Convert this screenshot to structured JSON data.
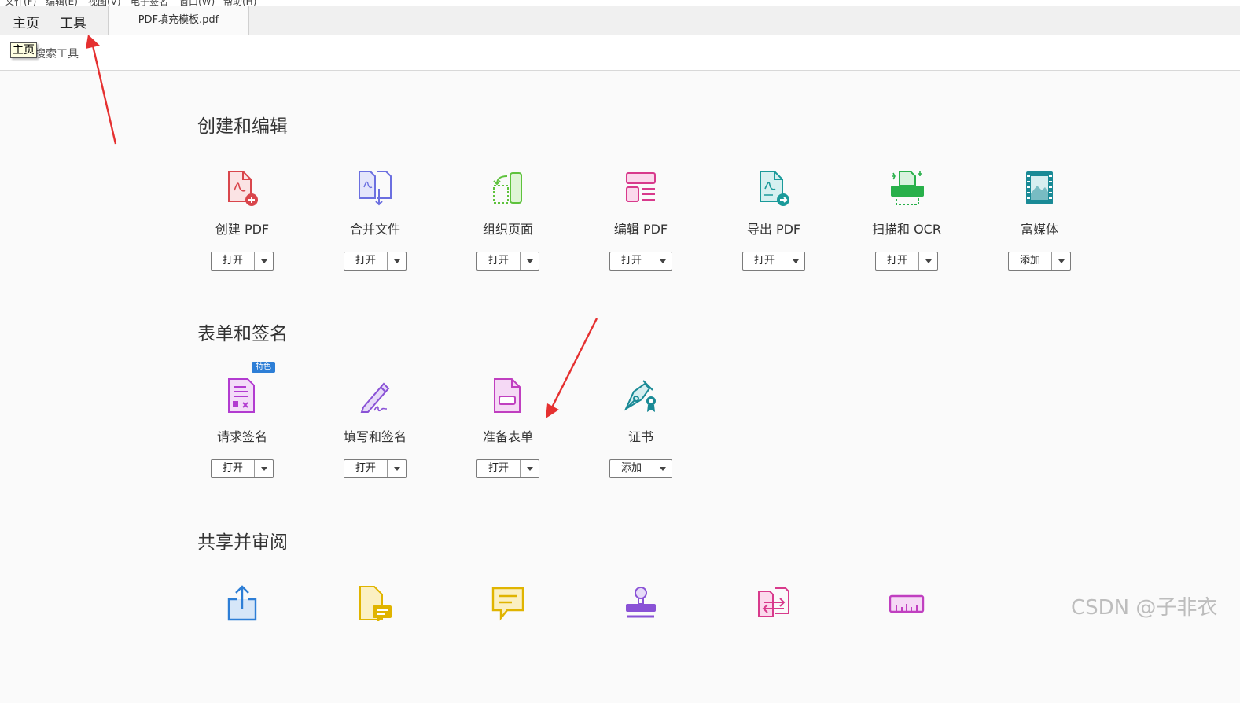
{
  "menubar": {
    "items": [
      "文件(F)",
      "编辑(E)",
      "视图(V)",
      "电子签名",
      "窗口(W)",
      "帮助(H)"
    ]
  },
  "tabs": {
    "home": "主页",
    "tools": "工具",
    "document": "PDF填充模板.pdf"
  },
  "search": {
    "placeholder": "搜索工具",
    "tooltip": "主页"
  },
  "sections": {
    "create": {
      "title": "创建和编辑",
      "tools": [
        {
          "label": "创建 PDF",
          "action": "打开",
          "icon": "create-pdf-icon",
          "color": "#d9464c"
        },
        {
          "label": "合并文件",
          "action": "打开",
          "icon": "combine-files-icon",
          "color": "#6b6fe0"
        },
        {
          "label": "组织页面",
          "action": "打开",
          "icon": "organize-pages-icon",
          "color": "#5ec23c"
        },
        {
          "label": "编辑 PDF",
          "action": "打开",
          "icon": "edit-pdf-icon",
          "color": "#d83a8c"
        },
        {
          "label": "导出 PDF",
          "action": "打开",
          "icon": "export-pdf-icon",
          "color": "#1a9a9a"
        },
        {
          "label": "扫描和 OCR",
          "action": "打开",
          "icon": "scan-ocr-icon",
          "color": "#28b04a"
        },
        {
          "label": "富媒体",
          "action": "添加",
          "icon": "rich-media-icon",
          "color": "#1a8a96"
        }
      ]
    },
    "forms": {
      "title": "表单和签名",
      "badge": "特色",
      "tools": [
        {
          "label": "请求签名",
          "action": "打开",
          "icon": "request-signature-icon",
          "color": "#b23bd0"
        },
        {
          "label": "填写和签名",
          "action": "打开",
          "icon": "fill-sign-icon",
          "color": "#8a52d6"
        },
        {
          "label": "准备表单",
          "action": "打开",
          "icon": "prepare-form-icon",
          "color": "#c03fc0"
        },
        {
          "label": "证书",
          "action": "添加",
          "icon": "certificate-icon",
          "color": "#1a8a96"
        }
      ]
    },
    "share": {
      "title": "共享并审阅",
      "tools": [
        {
          "icon": "share-icon",
          "color": "#2d7ed6"
        },
        {
          "icon": "comment-file-icon",
          "color": "#e0b400"
        },
        {
          "icon": "comment-icon",
          "color": "#e0b400"
        },
        {
          "icon": "stamp-icon",
          "color": "#8a52d6"
        },
        {
          "icon": "compare-files-icon",
          "color": "#d83a8c"
        },
        {
          "icon": "measure-icon",
          "color": "#c03fc0"
        }
      ]
    }
  },
  "watermark": "CSDN @子非衣",
  "annotation_color": "#e53030"
}
